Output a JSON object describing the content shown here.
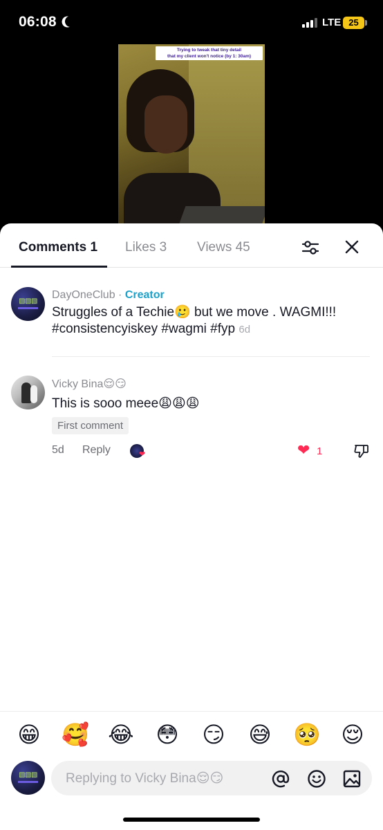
{
  "status_bar": {
    "time": "06:08",
    "network": "LTE",
    "battery": "25"
  },
  "video": {
    "caption_line1": "Trying to tweak that tiny detail",
    "caption_line2": "that my client won't notice (by 1: 30am)"
  },
  "tabs": [
    {
      "label": "Comments 1"
    },
    {
      "label": "Likes 3"
    },
    {
      "label": "Views 45"
    }
  ],
  "comments": [
    {
      "username": "DayOneClub",
      "separator": " · ",
      "role": "Creator",
      "text": "Struggles of a Techie🥲 but we move . WAGMI!!! #consistencyiskey #wagmi #fyp",
      "age": "6d"
    },
    {
      "username": "Vicky Bina😌😏",
      "text": "This is sooo meee😩😩😩",
      "badge": "First comment",
      "age": "5d",
      "reply_label": "Reply",
      "like_count": "1"
    }
  ],
  "emoji_bar": [
    "😁",
    "🥰",
    "😂",
    "😳",
    "😏",
    "😅",
    "🥺",
    "😌"
  ],
  "composer": {
    "placeholder": "Replying to Vicky Bina😌😏"
  },
  "colors": {
    "accent": "#fe2c55",
    "creator": "#1ea1c9",
    "text": "#161823",
    "muted": "#8a8b91"
  },
  "icons": [
    "moon-icon",
    "signal-icon",
    "battery-icon",
    "filter-icon",
    "close-icon",
    "heart-icon",
    "dislike-icon",
    "at-icon",
    "smile-icon",
    "image-icon"
  ]
}
